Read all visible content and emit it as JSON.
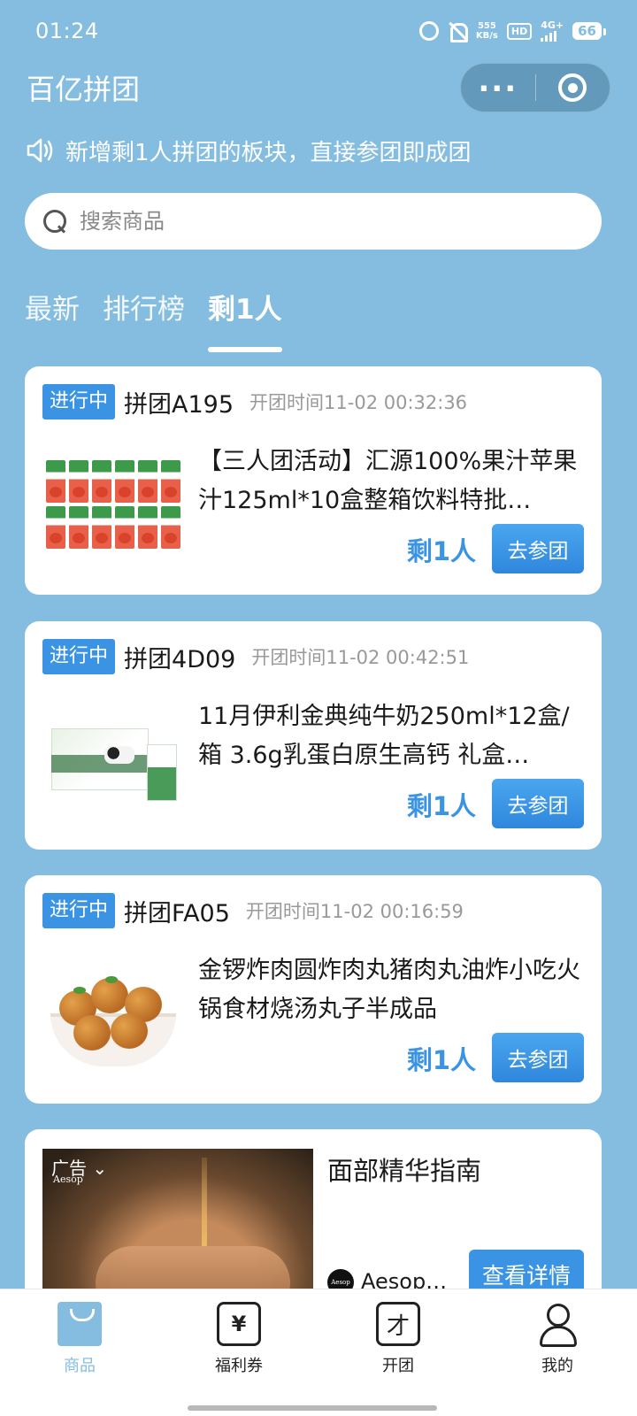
{
  "status_bar": {
    "time": "01:24",
    "net_speed_value": "555",
    "net_speed_unit": "KB/s",
    "hd": "HD",
    "network": "4G+",
    "battery": "66"
  },
  "header": {
    "title": "百亿拼团",
    "more_icon": "more-dots-icon",
    "close_icon": "target-circle-icon"
  },
  "notice": {
    "icon": "speaker-icon",
    "text": "新增剩1人拼团的板块，直接参团即成团"
  },
  "search": {
    "placeholder": "搜索商品"
  },
  "tabs": [
    {
      "label": "最新",
      "active": false
    },
    {
      "label": "排行榜",
      "active": false
    },
    {
      "label": "剩1人",
      "active": true
    }
  ],
  "cards": [
    {
      "status": "进行中",
      "group_id": "拼团A195",
      "open_time": "开团时间11-02 00:32:36",
      "title": "【三人团活动】汇源100%果汁苹果汁125ml*10盒整箱饮料特批…",
      "remaining": "剩1人",
      "button": "去参团"
    },
    {
      "status": "进行中",
      "group_id": "拼团4D09",
      "open_time": "开团时间11-02 00:42:51",
      "title": "11月伊利金典纯牛奶250ml*12盒/箱 3.6g乳蛋白原生高钙 礼盒…",
      "remaining": "剩1人",
      "button": "去参团"
    },
    {
      "status": "进行中",
      "group_id": "拼团FA05",
      "open_time": "开团时间11-02 00:16:59",
      "title": "金锣炸肉圆炸肉丸猪肉丸油炸小吃火锅食材烧汤丸子半成品",
      "remaining": "剩1人",
      "button": "去参团"
    }
  ],
  "ad": {
    "label": "广告",
    "brand_watermark": "Aesop",
    "title": "面部精华指南",
    "brand": "Aesop…",
    "logo_text": "Aesop",
    "button": "查看详情"
  },
  "bottom_nav": [
    {
      "label": "商品",
      "icon": "shopping-bag-icon",
      "active": true
    },
    {
      "label": "福利券",
      "icon": "coupon-icon",
      "glyph": "¥",
      "active": false
    },
    {
      "label": "开团",
      "icon": "open-group-icon",
      "glyph": "才",
      "active": false
    },
    {
      "label": "我的",
      "icon": "user-icon",
      "active": false
    }
  ]
}
